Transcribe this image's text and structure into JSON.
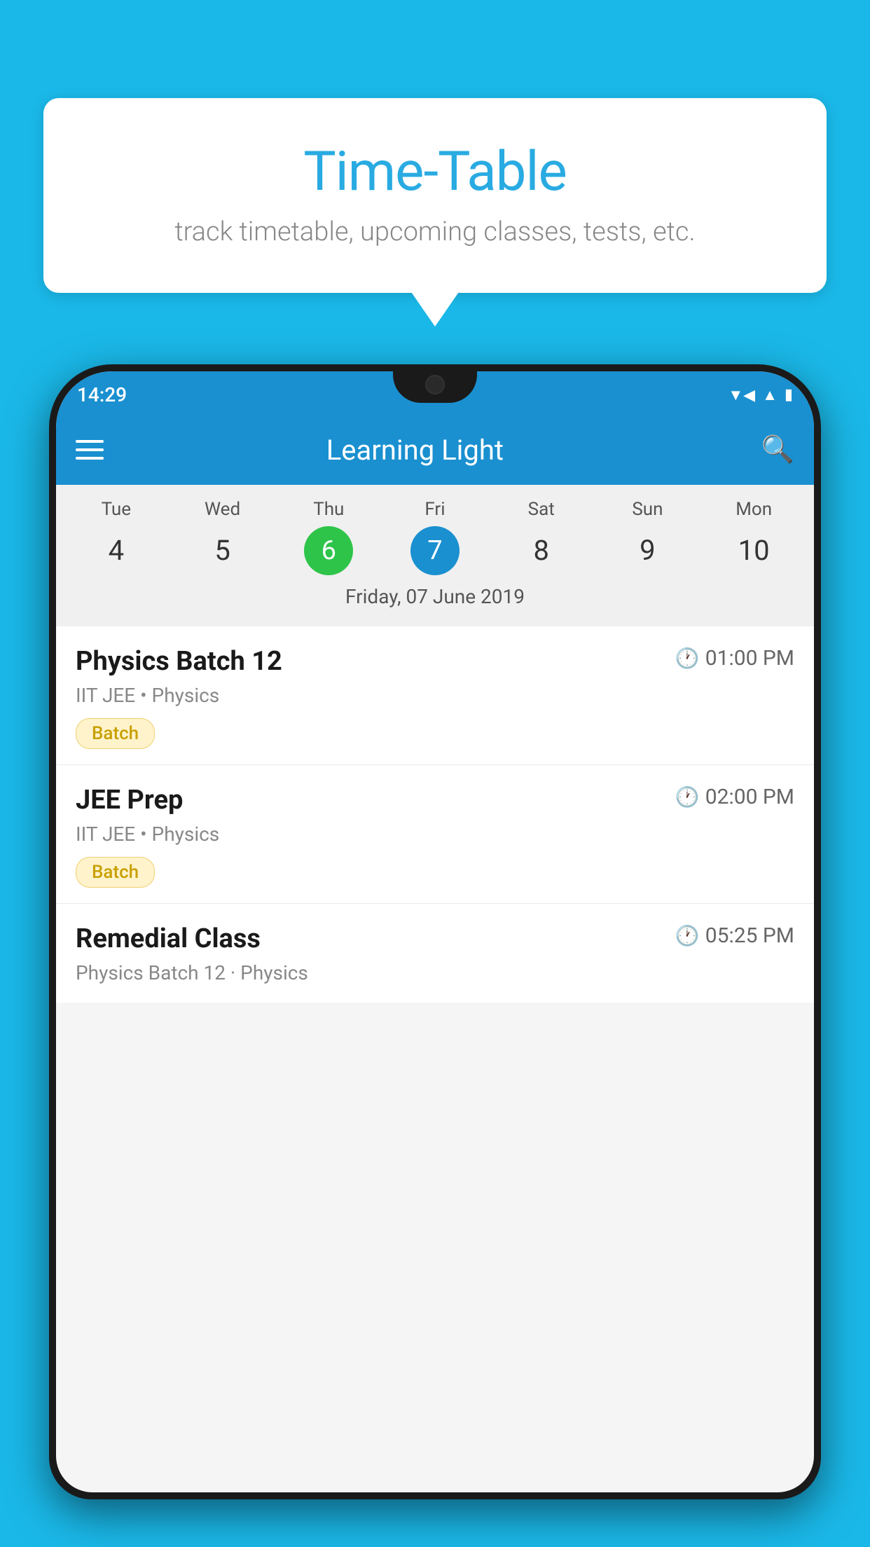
{
  "background_color": "#1ab8e8",
  "speech_bubble": {
    "title": "Time-Table",
    "subtitle": "track timetable, upcoming classes, tests, etc."
  },
  "phone": {
    "status_bar": {
      "time": "14:29",
      "icons": [
        "wifi",
        "signal",
        "battery"
      ]
    },
    "app_bar": {
      "title": "Learning Light",
      "menu_icon": "hamburger",
      "search_icon": "search"
    },
    "calendar": {
      "days": [
        {
          "label": "Tue",
          "number": "4"
        },
        {
          "label": "Wed",
          "number": "5"
        },
        {
          "label": "Thu",
          "number": "6",
          "state": "today"
        },
        {
          "label": "Fri",
          "number": "7",
          "state": "selected"
        },
        {
          "label": "Sat",
          "number": "8"
        },
        {
          "label": "Sun",
          "number": "9"
        },
        {
          "label": "Mon",
          "number": "10"
        }
      ],
      "selected_date_label": "Friday, 07 June 2019"
    },
    "schedule_items": [
      {
        "title": "Physics Batch 12",
        "time": "01:00 PM",
        "subject": "IIT JEE • Physics",
        "tag": "Batch"
      },
      {
        "title": "JEE Prep",
        "time": "02:00 PM",
        "subject": "IIT JEE • Physics",
        "tag": "Batch"
      },
      {
        "title": "Remedial Class",
        "time": "05:25 PM",
        "subject": "Physics Batch 12 · Physics",
        "tag": null
      }
    ]
  }
}
